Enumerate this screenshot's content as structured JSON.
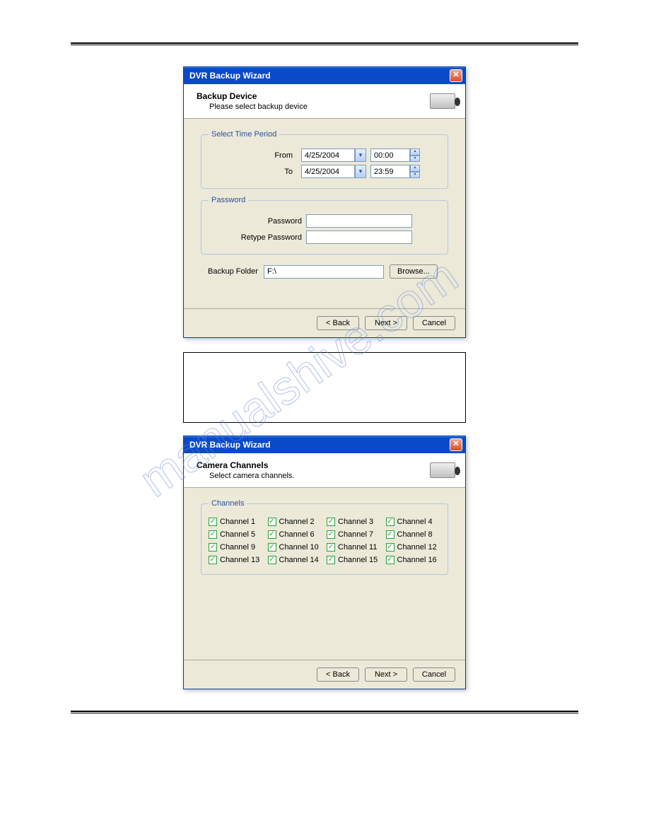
{
  "dialog1": {
    "title": "DVR Backup Wizard",
    "headerTitle": "Backup Device",
    "headerSub": "Please select backup device",
    "timeLegend": "Select Time Period",
    "fromLabel": "From",
    "fromDate": "4/25/2004",
    "fromTime": "00:00",
    "toLabel": "To",
    "toDate": "4/25/2004",
    "toTime": "23:59",
    "pwLegend": "Password",
    "pwLabel": "Password",
    "retypeLabel": "Retype Password",
    "folderLabel": "Backup Folder",
    "folderValue": "F:\\",
    "browse": "Browse...",
    "back": "< Back",
    "next": "Next >",
    "cancel": "Cancel"
  },
  "dialog2": {
    "title": "DVR Backup Wizard",
    "headerTitle": "Camera Channels",
    "headerSub": "Select camera channels.",
    "channelsLegend": "Channels",
    "channels": [
      "Channel 1",
      "Channel 2",
      "Channel 3",
      "Channel 4",
      "Channel 5",
      "Channel 6",
      "Channel 7",
      "Channel 8",
      "Channel 9",
      "Channel 10",
      "Channel 11",
      "Channel 12",
      "Channel 13",
      "Channel 14",
      "Channel 15",
      "Channel 16"
    ],
    "back": "< Back",
    "next": "Next >",
    "cancel": "Cancel"
  },
  "watermark": "manualshive.com"
}
